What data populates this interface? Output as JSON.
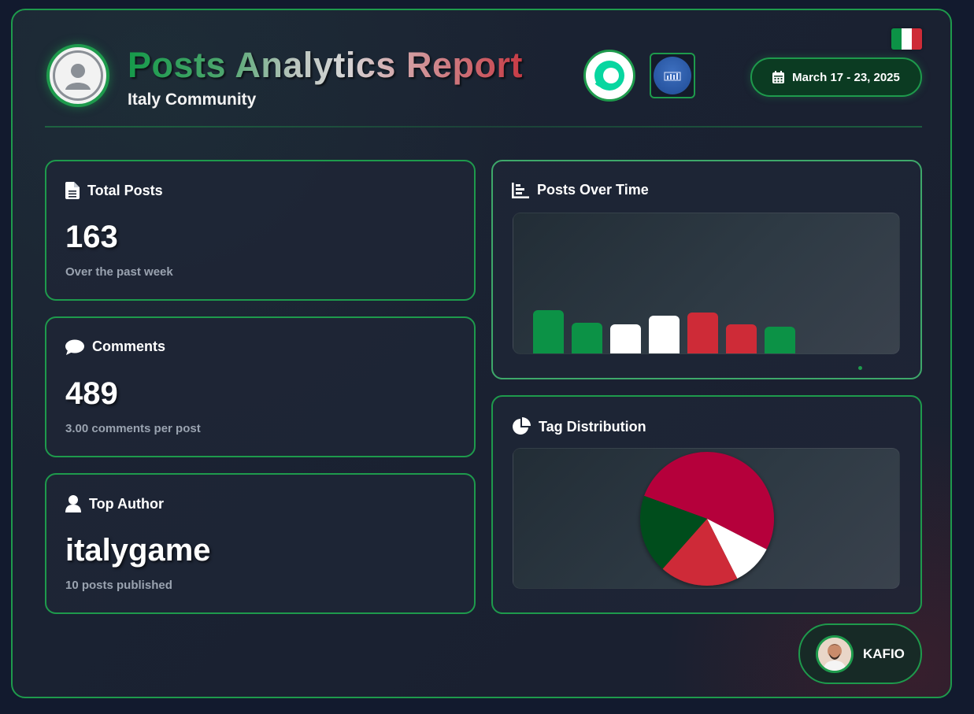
{
  "header": {
    "title": "Posts Analytics Report",
    "subtitle": "Italy Community",
    "date_range": "March 17 - 23, 2025",
    "brand_badges": [
      "steemit-logo-icon",
      "steem-stats-logo-icon"
    ]
  },
  "flag": {
    "colors": [
      "#0c9246",
      "#ffffff",
      "#ce2b37"
    ]
  },
  "stats": {
    "total_posts": {
      "label": "Total Posts",
      "value": "163",
      "note": "Over the past week",
      "icon": "file-icon"
    },
    "comments": {
      "label": "Comments",
      "value": "489",
      "note": "3.00 comments per post",
      "icon": "comment-icon"
    },
    "top_author": {
      "label": "Top Author",
      "value": "italygame",
      "note": "10 posts published",
      "icon": "user-icon"
    }
  },
  "posts_over_time": {
    "label": "Posts Over Time",
    "icon": "bar-chart-icon"
  },
  "tag_distribution": {
    "label": "Tag Distribution",
    "icon": "pie-chart-icon"
  },
  "chart_data": [
    {
      "type": "bar",
      "categories": [
        "",
        "",
        "",
        "",
        "",
        "",
        ""
      ],
      "values": [
        31,
        22,
        21,
        27,
        29,
        21,
        19
      ],
      "colors": [
        "#0c9246",
        "#0c9246",
        "#ffffff",
        "#ffffff",
        "#ce2b37",
        "#ce2b37",
        "#0c9246"
      ],
      "ylim": [
        0,
        100
      ]
    },
    {
      "type": "pie",
      "values": [
        52,
        10,
        19,
        19
      ],
      "colors": [
        "#b5003b",
        "#ffffff",
        "#ce2b37",
        "#004d1f"
      ]
    }
  ],
  "footer": {
    "author_name": "KAFIO"
  },
  "theme": {
    "accent": "#1e9a4c",
    "background": "#121a2e",
    "card": "#1e2636"
  }
}
